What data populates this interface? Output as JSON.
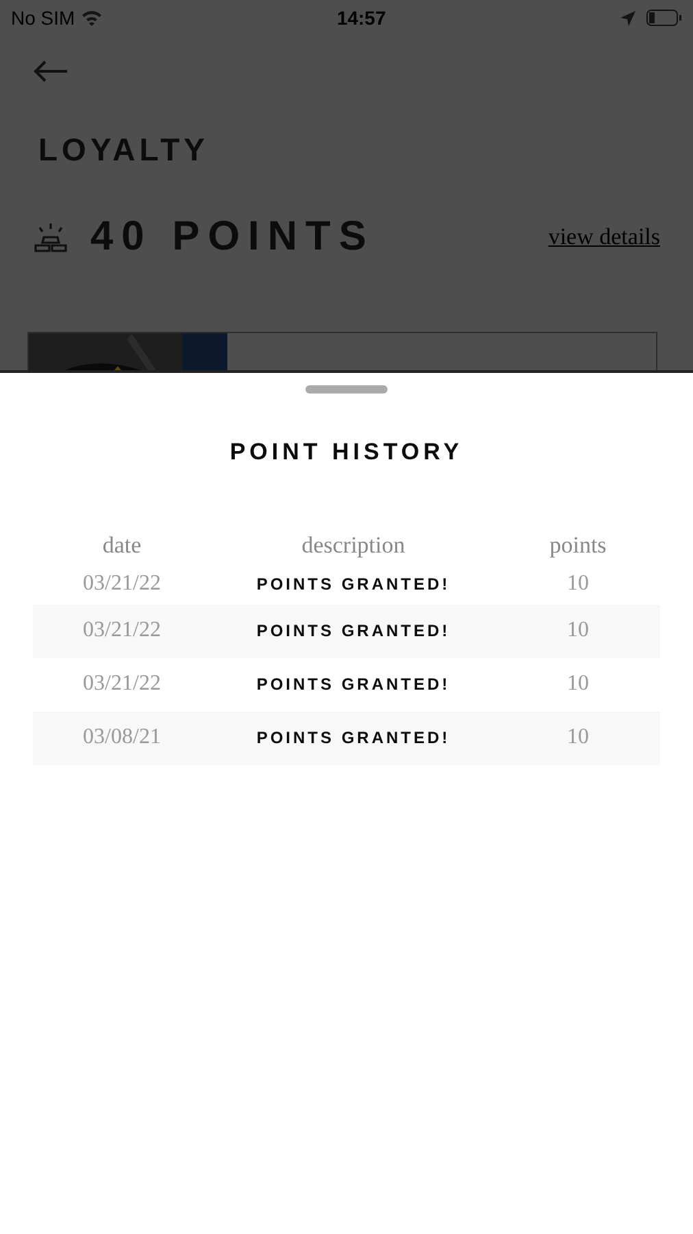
{
  "status_bar": {
    "carrier": "No SIM",
    "time": "14:57"
  },
  "page": {
    "title": "LOYALTY",
    "points": "40 POINTS",
    "link": "view details"
  },
  "sheet": {
    "title": "POINT HISTORY",
    "columns": [
      "date",
      "description",
      "points"
    ],
    "rows": [
      {
        "date": "03/21/22",
        "description": "POINTS GRANTED!",
        "points": "10"
      },
      {
        "date": "03/21/22",
        "description": "POINTS GRANTED!",
        "points": "10"
      },
      {
        "date": "03/21/22",
        "description": "POINTS GRANTED!",
        "points": "10"
      },
      {
        "date": "03/08/21",
        "description": "POINTS GRANTED!",
        "points": "10"
      }
    ]
  }
}
